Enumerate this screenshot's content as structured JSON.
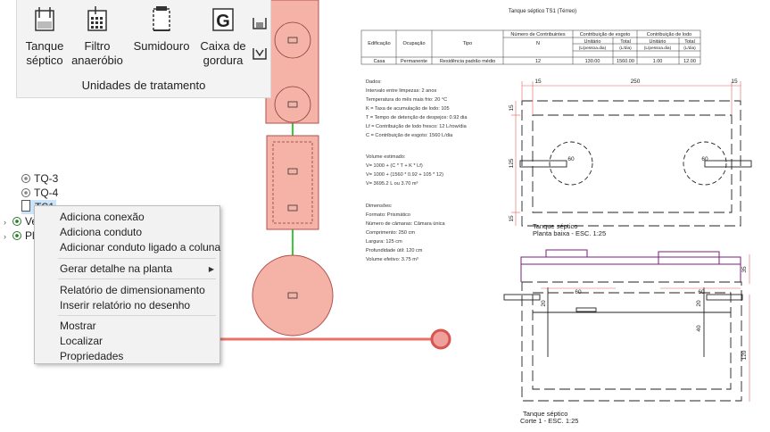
{
  "ribbon": {
    "buttons": [
      {
        "label": "Tanque\nséptico",
        "icon": "septic-tank-icon"
      },
      {
        "label": "Filtro\nanaeróbio",
        "icon": "anaerobic-filter-icon"
      },
      {
        "label": "Sumidouro",
        "icon": "sink-well-icon"
      },
      {
        "label": "Caixa de\ngordura",
        "icon": "grease-trap-icon"
      }
    ],
    "group_label": "Unidades de tratamento"
  },
  "tree": {
    "items": [
      "TQ-3",
      "TQ-4",
      "TS1",
      "Ve",
      "Plu"
    ]
  },
  "context_menu": {
    "items": [
      "Adiciona conexão",
      "Adiciona conduto",
      "Adicionar conduto ligado a coluna",
      "Gerar detalhe na planta",
      "Relatório de dimensionamento",
      "Inserir relatório no desenho",
      "Mostrar",
      "Localizar",
      "Propriedades"
    ]
  },
  "drawing": {
    "report": {
      "title": "Tanque séptico TS1 (Térreo)",
      "headers": {
        "edificacao": "Edificação",
        "ocupacao": "Ocupação",
        "tipo": "Tipo",
        "num_contrib": "Número de Contribuintes",
        "n": "N",
        "contrib_esgoto": "Contribuição de esgoto",
        "contrib_lodo": "Contribuição de lodo",
        "unitario": "Unitário",
        "total": "Total",
        "unit_esgoto": "(L/pessoa.dia)",
        "total_esgoto": "(L/dia)",
        "unit_lodo": "(L/pessoa.dia)",
        "total_lodo": "(L/dia)"
      },
      "row": {
        "edificacao": "Casa",
        "ocupacao": "Permanente",
        "tipo": "Residência padrão médio",
        "n": "12",
        "unit_esgoto": "130.00",
        "total_esgoto": "1560.00",
        "unit_lodo": "1.00",
        "total_lodo": "12.00"
      },
      "dados": [
        "Dados:",
        "Intervalo entre limpezas: 2 anos",
        "Temperatura do mês mais frio: 20 °C",
        "K = Taxa de acumulação de lodo: 105",
        "T = Tempo de detenção de despejos: 0.92 dia",
        "Lf = Contribuição de lodo fresco: 12 L/row/dia",
        "C = Contribuição de esgoto: 1560 L/dia"
      ],
      "volume": [
        "Volume estimado:",
        "V= 1000 + (C * T + K * Lf)",
        "V= 1000 + (1560 * 0.92 + 105 * 12)",
        "V= 3695.2 L ou 3.70 m³"
      ],
      "dimensoes": [
        "Dimensões:",
        "Formato: Prismático",
        "Número de câmaras: Câmara única",
        "Comprimento: 250 cm",
        "Largura: 125 cm",
        "Profundidade útil: 120 cm",
        "Volume efetivo: 3.75 m³"
      ]
    },
    "plan": {
      "caption_1": "Tanque séptico",
      "caption_2": "Planta baixa - ESC. 1:25",
      "dims": {
        "top_left": "15",
        "top_mid": "250",
        "top_right": "15",
        "side_top": "15",
        "side_mid": "125",
        "side_bottom": "15",
        "circle_left": "60",
        "circle_right": "60"
      }
    },
    "section": {
      "caption_1": "Tanque séptico",
      "caption_2": "Corte 1 - ESC. 1:25",
      "dims": {
        "d35": "35",
        "d60a": "60",
        "d60b": "60",
        "d20a": "20",
        "d20b": "20",
        "d40": "40",
        "d120": "120"
      }
    }
  },
  "colors": {
    "accent": "#e8726a",
    "tank_fill": "#f4b3a6",
    "pipe": "#3cc83c",
    "section_purple": "#7a1f7a",
    "selection": "#cce4f7"
  }
}
